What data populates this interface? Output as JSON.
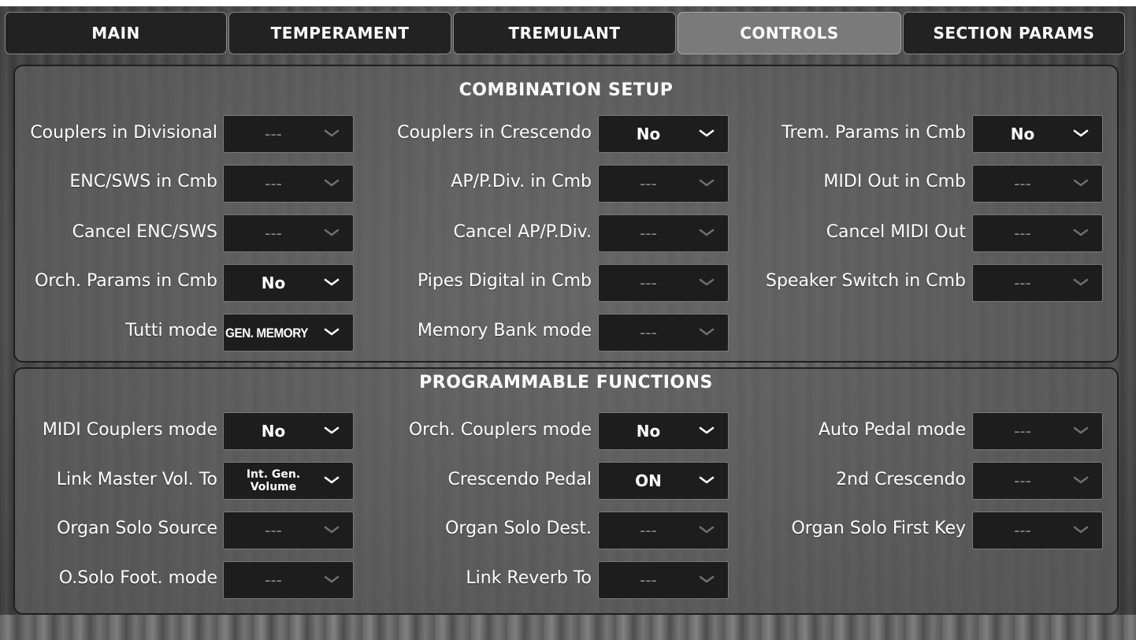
{
  "tabs": [
    {
      "label": "MAIN",
      "active": false
    },
    {
      "label": "TEMPERAMENT",
      "active": false
    },
    {
      "label": "TREMULANT",
      "active": false
    },
    {
      "label": "CONTROLS",
      "active": true
    },
    {
      "label": "SECTION PARAMS",
      "active": false
    }
  ],
  "combination_setup": {
    "title": "COMBINATION SETUP",
    "rows": [
      [
        {
          "label": "Couplers in Divisional",
          "value": "---",
          "icon": "chevron-down-icon"
        },
        {
          "label": "Couplers in Crescendo",
          "value": "No",
          "icon": "chevron-down-icon"
        },
        {
          "label": "Trem. Params in Cmb",
          "value": "No",
          "icon": "chevron-down-icon"
        }
      ],
      [
        {
          "label": "ENC/SWS in Cmb",
          "value": "---",
          "icon": "chevron-down-icon"
        },
        {
          "label": "AP/P.Div. in Cmb",
          "value": "---",
          "icon": "chevron-down-icon"
        },
        {
          "label": "MIDI Out in Cmb",
          "value": "---",
          "icon": "chevron-down-icon"
        }
      ],
      [
        {
          "label": "Cancel ENC/SWS",
          "value": "---",
          "icon": "chevron-down-icon"
        },
        {
          "label": "Cancel AP/P.Div.",
          "value": "---",
          "icon": "chevron-down-icon"
        },
        {
          "label": "Cancel MIDI Out",
          "value": "---",
          "icon": "chevron-down-icon"
        }
      ],
      [
        {
          "label": "Orch. Params in Cmb",
          "value": "No",
          "icon": "chevron-down-icon"
        },
        {
          "label": "Pipes Digital in Cmb",
          "value": "---",
          "icon": "chevron-down-icon"
        },
        {
          "label": "Speaker Switch in Cmb",
          "value": "---",
          "icon": "chevron-down-icon"
        }
      ],
      [
        {
          "label": "Tutti mode",
          "value": "GEN. MEMORY",
          "icon": "chevron-down-icon"
        },
        {
          "label": "Memory Bank mode",
          "value": "---",
          "icon": "chevron-down-icon"
        }
      ]
    ]
  },
  "programmable_functions": {
    "title": "PROGRAMMABLE FUNCTIONS",
    "rows": [
      [
        {
          "label": "MIDI Couplers mode",
          "value": "No",
          "icon": "chevron-down-icon"
        },
        {
          "label": "Orch. Couplers mode",
          "value": "No",
          "icon": "chevron-down-icon"
        },
        {
          "label": "Auto Pedal mode",
          "value": "---",
          "icon": "chevron-down-icon"
        }
      ],
      [
        {
          "label": "Link Master Vol. To",
          "value": "Int. Gen.\nVolume",
          "icon": "chevron-down-icon"
        },
        {
          "label": "Crescendo Pedal",
          "value": "ON",
          "icon": "chevron-down-icon"
        },
        {
          "label": "2nd Crescendo",
          "value": "---",
          "icon": "chevron-down-icon"
        }
      ],
      [
        {
          "label": "Organ Solo Source",
          "value": "---",
          "icon": "chevron-down-icon"
        },
        {
          "label": "Organ Solo Dest.",
          "value": "---",
          "icon": "chevron-down-icon"
        },
        {
          "label": "Organ Solo First Key",
          "value": "---",
          "icon": "chevron-down-icon"
        }
      ],
      [
        {
          "label": "O.Solo Foot. mode",
          "value": "---",
          "icon": "chevron-down-icon"
        },
        {
          "label": "Link Reverb To",
          "value": "---",
          "icon": "chevron-down-icon"
        }
      ]
    ]
  }
}
